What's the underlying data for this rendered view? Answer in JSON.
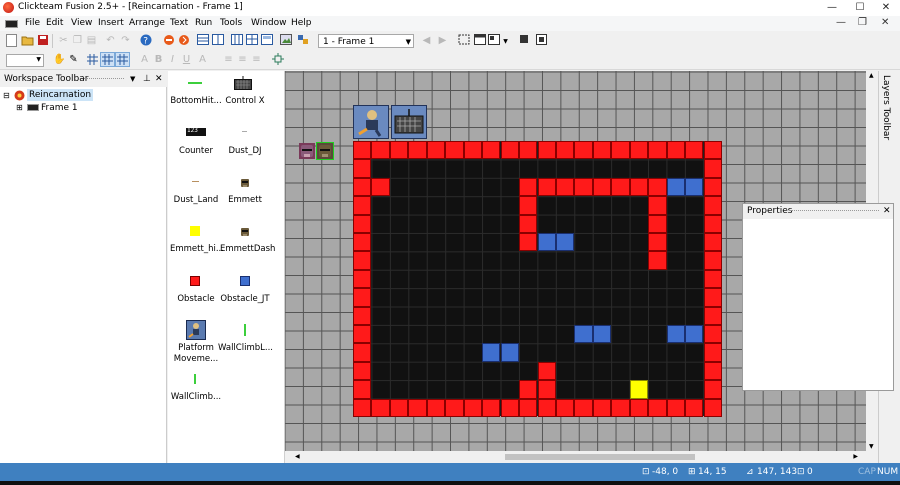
{
  "window": {
    "title": "Clickteam Fusion 2.5+ - [Reincarnation - Frame 1]",
    "controls": {
      "minimize": "—",
      "maximize": "☐",
      "close": "✕"
    }
  },
  "menu": {
    "items": [
      "File",
      "Edit",
      "View",
      "Insert",
      "Arrange",
      "Text",
      "Run",
      "Tools",
      "Window",
      "Help"
    ],
    "mdi_controls": {
      "minimize": "—",
      "restore": "❐",
      "close": "✕"
    }
  },
  "toolbar": {
    "frame_select_value": "1 - Frame 1",
    "font_bold": "B",
    "font_italic": "I",
    "font_underline": "U"
  },
  "workspace": {
    "title": "Workspace Toolbar",
    "tree": [
      {
        "label": "Reincarnation",
        "level": 0,
        "expanded": true,
        "selected": true
      },
      {
        "label": "Frame 1",
        "level": 1,
        "expanded": false,
        "selected": false
      }
    ]
  },
  "objects": [
    {
      "label": "BottomHit...",
      "icon": "green-line-icon"
    },
    {
      "label": "Control X",
      "icon": "keyboard-icon"
    },
    {
      "label": "Counter",
      "icon": "counter-icon"
    },
    {
      "label": "Dust_DJ",
      "icon": "dust-icon"
    },
    {
      "label": "Dust_Land",
      "icon": "dust-icon"
    },
    {
      "label": "Emmett",
      "icon": "character-icon"
    },
    {
      "label": "Emmett_hi...",
      "icon": "yellow-square-icon"
    },
    {
      "label": "EmmettDash",
      "icon": "character-icon"
    },
    {
      "label": "Obstacle",
      "icon": "red-square-icon"
    },
    {
      "label": "Obstacle_JT",
      "icon": "blue-square-icon"
    },
    {
      "label": "Platform\nMoveme...",
      "icon": "platform-movement-icon"
    },
    {
      "label": "WallClimbL...",
      "icon": "green-line-icon"
    },
    {
      "label": "WallClimb...",
      "icon": "green-line-icon"
    }
  ],
  "side_panels": {
    "layers_toolbar": "Layers Toolbar",
    "properties_title": "Properties"
  },
  "status": {
    "cursor_pos": "-48, 0",
    "grid_pos": "14, 15",
    "size": "147, 143",
    "angle": "0",
    "caps": "CAP",
    "num": "NUM"
  },
  "colors": {
    "obstacle": "#ff1a1a",
    "obstacle_jt": "#3f6fcf",
    "emmett_hitbox": "#ffff00",
    "status_bar": "#3f80c0"
  }
}
